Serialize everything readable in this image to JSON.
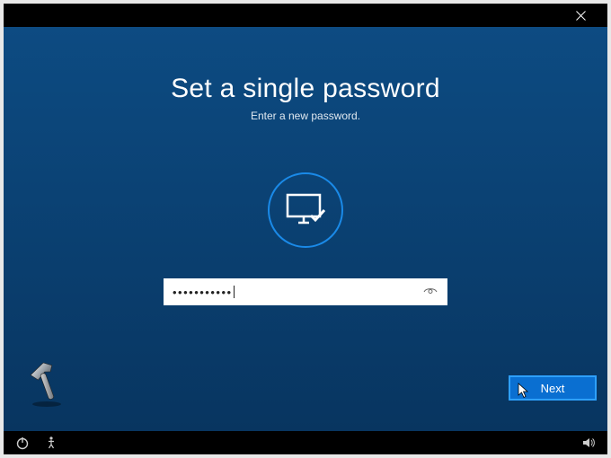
{
  "titlebar": {
    "close_label": "Close"
  },
  "page": {
    "title": "Set a single password",
    "subtitle": "Enter a new password."
  },
  "input": {
    "masked_value": "•••••••••••",
    "reveal_label": "Reveal password"
  },
  "actions": {
    "next_label": "Next"
  },
  "bottombar": {
    "power_label": "Power",
    "ease_of_access_label": "Ease of access",
    "volume_label": "Volume"
  },
  "icons": {
    "monitor": "monitor-check-icon",
    "hammer": "hammer-icon"
  },
  "colors": {
    "accent": "#1a8ae8",
    "button": "#0a6fd1",
    "background": "#0a3e6e"
  }
}
